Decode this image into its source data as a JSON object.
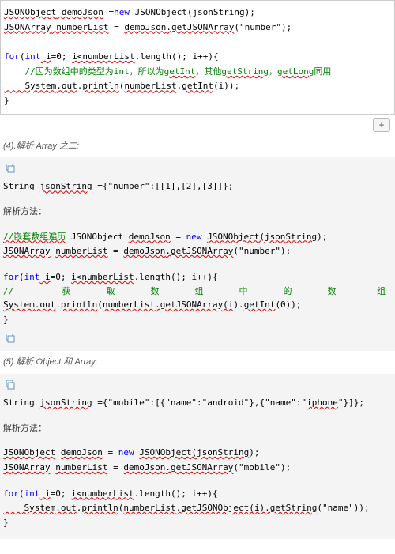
{
  "box1": {
    "l1a": "JSONObject",
    "l1b": " demoJson",
    "l1c": " =",
    "l1d": "new",
    "l1e": " JSONObject(jsonString);",
    "l2a": "JSONArray",
    "l2b": " numberList",
    "l2c": " = ",
    "l2d": "demoJson",
    "l2e": ".getJSONArray",
    "l2f": "(\"number\"",
    "l2g": ");",
    "l3a": "for",
    "l3b": "(",
    "l3c": "int",
    "l3d": " i",
    "l3e": "=0; ",
    "l3f": "i<numberList",
    "l3g": ".length(); i++){",
    "l4a": "    //因为数组中的类型为",
    "l4b": "int",
    "l4c": "，所以为",
    "l4d": "getInt",
    "l4e": "，其他",
    "l4f": "getString",
    "l4g": "，",
    "l4h": "getLong",
    "l4i": "同用",
    "l5a": "    System",
    "l5b": ".out",
    "l5c": ".",
    "l5d": "println",
    "l5e": "(",
    "l5f": "numberList",
    "l5g": ".",
    "l5h": "getInt",
    "l5i": "(i));",
    "l6": "}"
  },
  "plus": "+",
  "sec4_title": "(4).解析 Array 之二:",
  "block2": {
    "l1a": "String ",
    "l1b": "jsonString",
    "l1c": " ={\"number\":[[1],[2],[3]]};",
    "method_label": "解析方法：",
    "l3a": "//嵌套数组遍历",
    "l3b": " JSONObject ",
    "l3c": "demoJson",
    "l3d": " = ",
    "l3e": "new",
    "l3f": " ",
    "l3g": "JSONObject(jsonString",
    "l3h": ");",
    "l4a": "JSONArray",
    "l4b": " ",
    "l4c": "numberList",
    "l4d": " = ",
    "l4e": "demoJson",
    "l4f": ".getJSONArray",
    "l4g": "(\"number\");",
    "l5a": "for",
    "l5b": "(",
    "l5c": "int",
    "l5d": " i",
    "l5e": "=0; ",
    "l5f": "i<numberList",
    "l5g": ".length(); i++){",
    "cmt_slash": "//",
    "cmt_c1": "获",
    "cmt_c2": "取",
    "cmt_c3": "数",
    "cmt_c4": "组",
    "cmt_c5": "中",
    "cmt_c6": "的",
    "cmt_c7": "数",
    "cmt_c8": "组",
    "l7a": "System",
    "l7b": ".out",
    "l7c": ".",
    "l7d": "println",
    "l7e": "(",
    "l7f": "numberList",
    "l7g": ".getJSONArray(i",
    "l7h": ").",
    "l7i": "getInt",
    "l7j": "(0));",
    "l8": "}"
  },
  "sec5_title": "(5).解析 Object 和 Array:",
  "block3": {
    "l1a": "String ",
    "l1b": "jsonString",
    "l1c": " ={\"mobile\":[{\"name\":\"android\"},{\"name\":\"",
    "l1d": "iphone",
    "l1e": "\"}]};",
    "method_label": "解析方法：",
    "l3a": "JSONObject",
    "l3b": " ",
    "l3c": "demoJson",
    "l3d": " = ",
    "l3e": "new",
    "l3f": " ",
    "l3g": "JSONObject(jsonString",
    "l3h": ");",
    "l4a": "JSONArray",
    "l4b": " ",
    "l4c": "numberList",
    "l4d": " = ",
    "l4e": "demoJson",
    "l4f": ".getJSONArray",
    "l4g": "(\"mobile\");",
    "l5a": "for",
    "l5b": "(",
    "l5c": "int",
    "l5d": " i",
    "l5e": "=0; ",
    "l5f": "i<numberList",
    "l5g": ".length(); i++){",
    "l6a": "    System",
    "l6b": ".out",
    "l6c": ".",
    "l6d": "println",
    "l6e": "(",
    "l6f": "numberList",
    "l6g": ".getJSONObject(i",
    "l6h": ").getString",
    "l6i": "(\"name\"));",
    "l7": "}"
  }
}
